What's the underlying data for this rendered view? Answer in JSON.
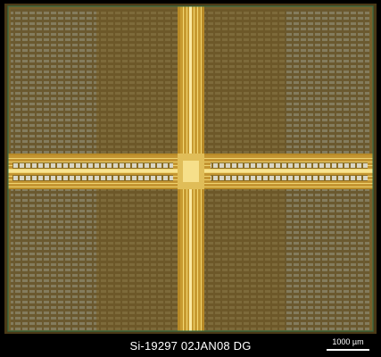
{
  "caption": {
    "text": "Si-19297  02JAN08  DG"
  },
  "scale_bar": {
    "label": "1000 µm"
  },
  "colors": {
    "background": "#000000",
    "die_base": "#7a5f2a",
    "memory_array": "#6e5a2e",
    "bus_gold": "#d6b044",
    "bus_highlight": "#f4dc7a",
    "bond_pad": "#cfd3cc",
    "caption_text": "#ffffff"
  }
}
